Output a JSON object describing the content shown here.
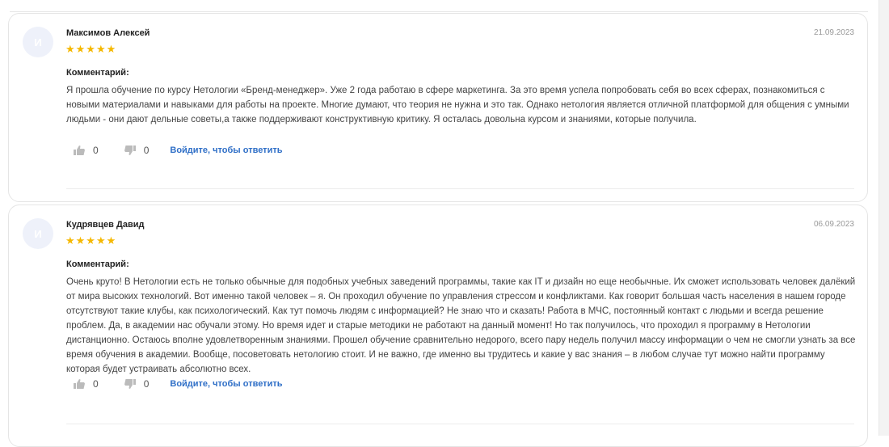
{
  "reviews": [
    {
      "avatar_letter": "И",
      "author": "Максимов Алексей",
      "date": "21.09.2023",
      "rating": 5,
      "stars": "★★★★★",
      "comment_label": "Комментарий:",
      "comment": "Я прошла обучение по курсу Нетологии «Бренд-менеджер». Уже 2 года работаю в сфере маркетинга. За это время успела попробовать себя во всех сферах, познакомиться с новыми материалами и навыками для работы на проекте. Многие думают, что теория не нужна и это так. Однако нетология является отличной платформой для общения с умными людьми - они дают дельные советы,а также поддерживают конструктивную критику. Я осталась довольна курсом и знаниями, которые получила.",
      "likes": "0",
      "dislikes": "0",
      "reply_label": "Войдите, чтобы ответить"
    },
    {
      "avatar_letter": "И",
      "author": "Кудрявцев Давид",
      "date": "06.09.2023",
      "rating": 5,
      "stars": "★★★★★",
      "comment_label": "Комментарий:",
      "comment": "Очень круто! В Нетологии есть не только обычные для подобных учебных заведений программы, такие как IT и дизайн но еще необычные. Их сможет использовать человек далёкий от мира высоких технологий. Вот именно такой человек – я. Он проходил обучение по управления стрессом и конфликтами. Как говорит большая часть населения в нашем городе отсутствуют такие клубы, как психологический. Как тут помочь людям с информацией? Не знаю что и сказать! Работа в МЧС, постоянный контакт с людьми и всегда решение проблем. Да, в академии нас обучали этому. Но время идет и старые методики не работают на данный момент! Но так получилось, что проходил я программу в Нетологии дистанционно. Остаюсь вполне удовлетворенным знаниями. Прошел обучение сравнительно недорого, всего пару недель получил массу информации о чем не смогли узнать за все время обучения в академии. Вообще, посоветовать нетологию стоит. И не важно, где именно вы трудитесь и какие у вас знания – в любом случае тут можно найти программу которая будет устраивать абсолютно всех.",
      "likes": "0",
      "dislikes": "0",
      "reply_label": "Войдите, чтобы ответить"
    }
  ],
  "icons": {
    "like": "thumbs-up-icon",
    "dislike": "thumbs-down-icon"
  },
  "colors": {
    "star": "#f5b800",
    "link": "#2f6fc7",
    "avatar_bg": "#eef1fa"
  }
}
